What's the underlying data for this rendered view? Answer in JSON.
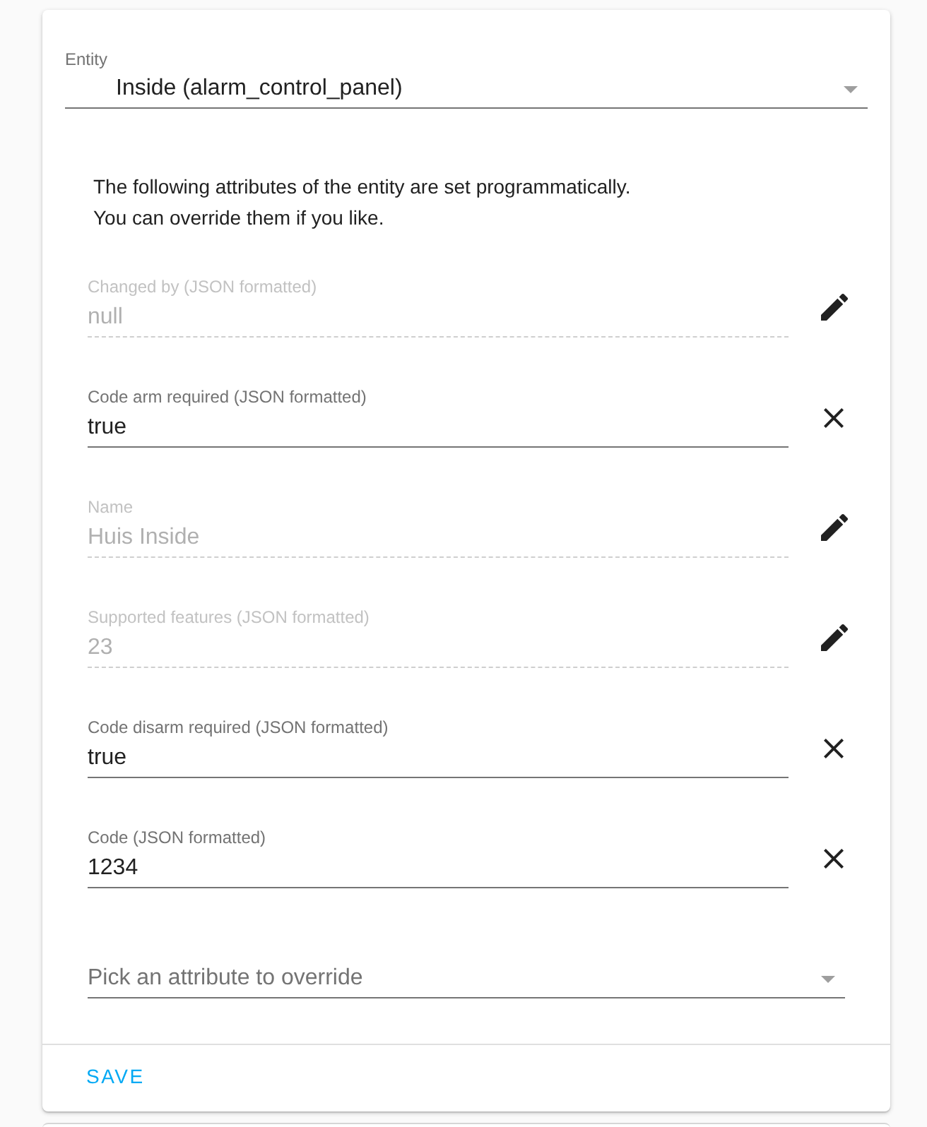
{
  "entity": {
    "label": "Entity",
    "value": "Inside (alarm_control_panel)"
  },
  "description_lines": [
    "The following attributes of the entity are set programmatically.",
    "You can override them if you like."
  ],
  "attributes": [
    {
      "label": "Changed by (JSON formatted)",
      "value": "null",
      "disabled": true
    },
    {
      "label": "Code arm required (JSON formatted)",
      "value": "true",
      "disabled": false
    },
    {
      "label": "Name",
      "value": "Huis Inside",
      "disabled": true
    },
    {
      "label": "Supported features (JSON formatted)",
      "value": "23",
      "disabled": true
    },
    {
      "label": "Code disarm required (JSON formatted)",
      "value": "true",
      "disabled": false
    },
    {
      "label": "Code (JSON formatted)",
      "value": "1234",
      "disabled": false
    }
  ],
  "attribute_picker": {
    "placeholder": "Pick an attribute to override"
  },
  "save_button": {
    "label": "SAVE"
  }
}
